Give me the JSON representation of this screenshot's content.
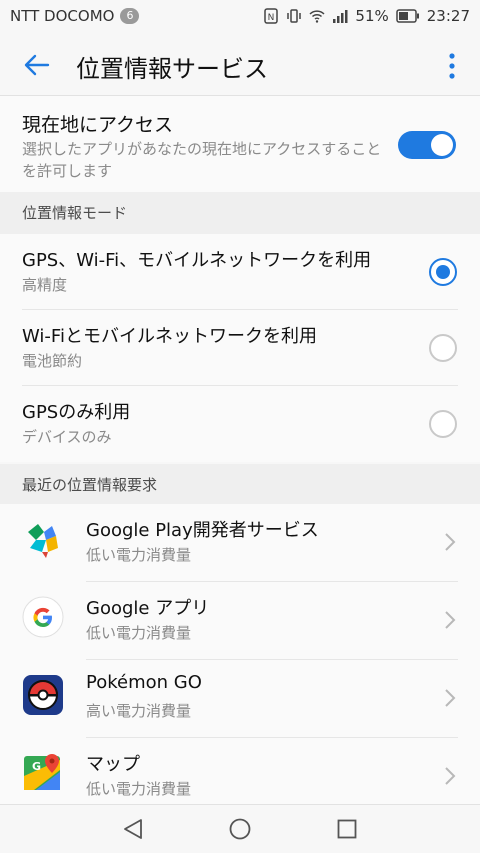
{
  "status_bar": {
    "carrier": "NTT DOCOMO",
    "badge": "6",
    "battery": "51%",
    "time": "23:27"
  },
  "app_bar": {
    "title": "位置情報サービス",
    "back_icon": "arrow-left-icon",
    "menu_icon": "more-vert-icon"
  },
  "access": {
    "title": "現在地にアクセス",
    "subtitle": "選択したアプリがあなたの現在地にアクセスすることを許可します",
    "enabled": true
  },
  "mode_section": {
    "header": "位置情報モード",
    "options": [
      {
        "title": "GPS、Wi-Fi、モバイルネットワークを利用",
        "subtitle": "高精度",
        "selected": true
      },
      {
        "title": "Wi-Fiとモバイルネットワークを利用",
        "subtitle": "電池節約",
        "selected": false
      },
      {
        "title": "GPSのみ利用",
        "subtitle": "デバイスのみ",
        "selected": false
      }
    ]
  },
  "recent_section": {
    "header": "最近の位置情報要求",
    "apps": [
      {
        "name": "Google Play開発者サービス",
        "usage": "低い電力消費量",
        "icon": "google-play-services-icon"
      },
      {
        "name": "Google アプリ",
        "usage": "低い電力消費量",
        "icon": "google-g-icon"
      },
      {
        "name": "Pokémon GO",
        "usage": "高い電力消費量",
        "icon": "pokeball-icon"
      },
      {
        "name": "マップ",
        "usage": "低い電力消費量",
        "icon": "google-maps-icon"
      }
    ]
  },
  "colors": {
    "accent": "#1f7ae0",
    "background": "#f7f7f7",
    "section_bg": "#efefef"
  }
}
